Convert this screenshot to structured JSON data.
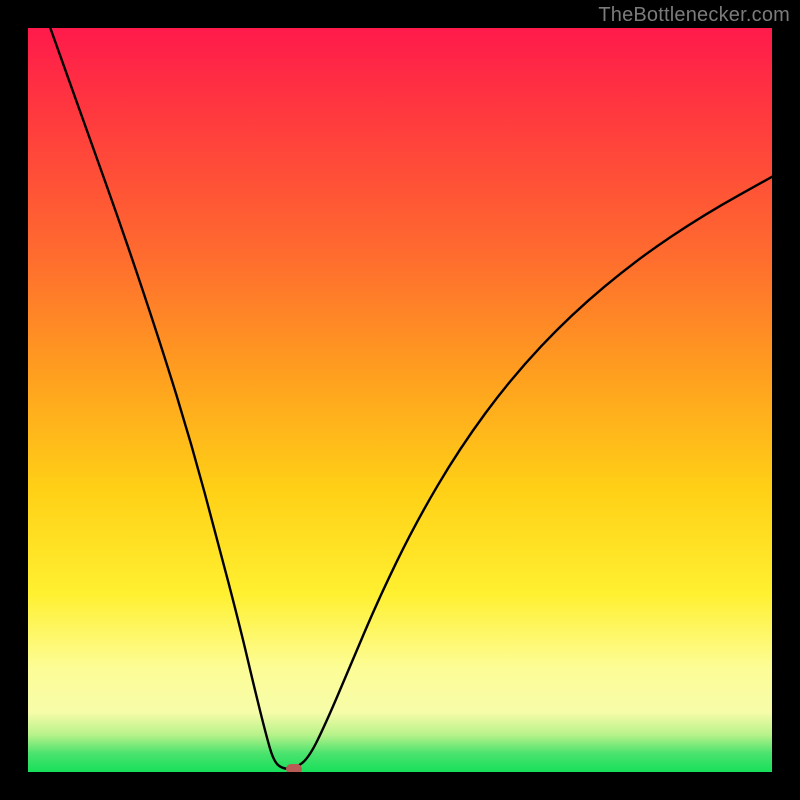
{
  "watermark": "TheBottlenecker.com",
  "chart_data": {
    "type": "line",
    "title": "",
    "xlabel": "",
    "ylabel": "",
    "xlim": [
      0,
      1
    ],
    "ylim": [
      0,
      1
    ],
    "series": [
      {
        "name": "curve",
        "points": [
          {
            "x": 0.03,
            "y": 1.0
          },
          {
            "x": 0.08,
            "y": 0.86
          },
          {
            "x": 0.13,
            "y": 0.72
          },
          {
            "x": 0.18,
            "y": 0.57
          },
          {
            "x": 0.22,
            "y": 0.44
          },
          {
            "x": 0.255,
            "y": 0.31
          },
          {
            "x": 0.285,
            "y": 0.195
          },
          {
            "x": 0.305,
            "y": 0.11
          },
          {
            "x": 0.32,
            "y": 0.05
          },
          {
            "x": 0.33,
            "y": 0.015
          },
          {
            "x": 0.342,
            "y": 0.004
          },
          {
            "x": 0.36,
            "y": 0.005
          },
          {
            "x": 0.378,
            "y": 0.02
          },
          {
            "x": 0.4,
            "y": 0.065
          },
          {
            "x": 0.43,
            "y": 0.135
          },
          {
            "x": 0.47,
            "y": 0.23
          },
          {
            "x": 0.52,
            "y": 0.333
          },
          {
            "x": 0.58,
            "y": 0.435
          },
          {
            "x": 0.65,
            "y": 0.53
          },
          {
            "x": 0.73,
            "y": 0.615
          },
          {
            "x": 0.82,
            "y": 0.69
          },
          {
            "x": 0.91,
            "y": 0.75
          },
          {
            "x": 1.0,
            "y": 0.8
          }
        ]
      }
    ],
    "marker": {
      "x": 0.357,
      "y": 0.0
    },
    "gradient_stops": [
      {
        "pos": 0.0,
        "color": "#ff1a4b"
      },
      {
        "pos": 0.5,
        "color": "#ffb51c"
      },
      {
        "pos": 0.8,
        "color": "#fff04a"
      },
      {
        "pos": 0.97,
        "color": "#4be36e"
      },
      {
        "pos": 1.0,
        "color": "#16df5a"
      }
    ]
  }
}
